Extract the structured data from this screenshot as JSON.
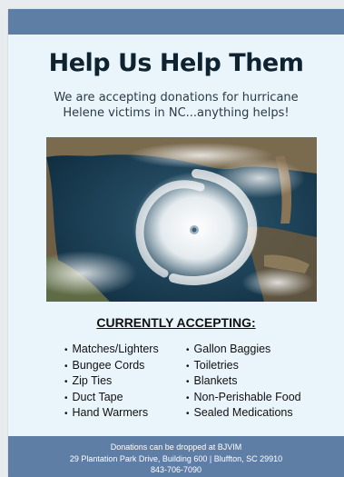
{
  "flyer": {
    "headline": "Help Us Help Them",
    "intro_line1": "We are accepting donations for hurricane",
    "intro_line2": "Helene victims in NC...anything helps!",
    "section_title": "CURRENTLY ACCEPTING:",
    "left_items": [
      "Matches/Lighters",
      "Bungee Cords",
      "Zip Ties",
      "Duct Tape",
      "Hand Warmers"
    ],
    "right_items": [
      "Gallon Baggies",
      "Toiletries",
      "Blankets",
      "Non-Perishable Food",
      "Sealed Medications"
    ],
    "footer": {
      "line1": "Donations can be dropped at BJVIM",
      "line2": "29 Plantation Park Drive, Building 600 | Bluffton, SC 29910",
      "line3": "843-706-7090"
    },
    "colors": {
      "band": "#5f7ea6",
      "background": "#eaf4fb",
      "headline": "#0f2230"
    }
  }
}
